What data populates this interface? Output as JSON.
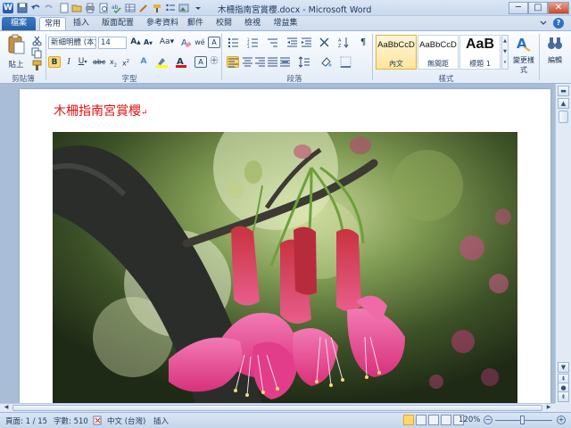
{
  "app": {
    "window_title": "木柵指南宮賞櫻.docx - Microsoft Word",
    "window_controls": [
      "─",
      "□",
      "✕"
    ]
  },
  "ribbon_tabs": [
    "檔案",
    "常用",
    "插入",
    "版面配置",
    "參考資料",
    "郵件",
    "校閱",
    "檢視",
    "增益集"
  ],
  "clipboard": {
    "paste_label": "貼上",
    "group_label": "剪貼簿"
  },
  "font": {
    "font_name": "新細明體 (本文",
    "font_size": "14",
    "group_label": "字型",
    "text_color": "#e01010",
    "highlight_color": "#ffff00"
  },
  "paragraph": {
    "group_label": "段落"
  },
  "styles": {
    "group_label": "樣式",
    "tiles": [
      {
        "preview": "AaBbCcD",
        "name": "內文",
        "selected": true
      },
      {
        "preview": "AaBbCcD",
        "name": "無間距",
        "selected": false
      },
      {
        "preview": "AaB",
        "name": "標題 1",
        "selected": false
      }
    ],
    "change_styles_label": "變更樣式",
    "editing_label": "編輯"
  },
  "document": {
    "heading": "木柵指南宮賞櫻",
    "paragraph_mark": "↵"
  },
  "status": {
    "page": "頁面: 1 / 15",
    "words": "字數: 510",
    "language": "中文 (台灣)",
    "mode": "插入",
    "zoom": "120%"
  }
}
